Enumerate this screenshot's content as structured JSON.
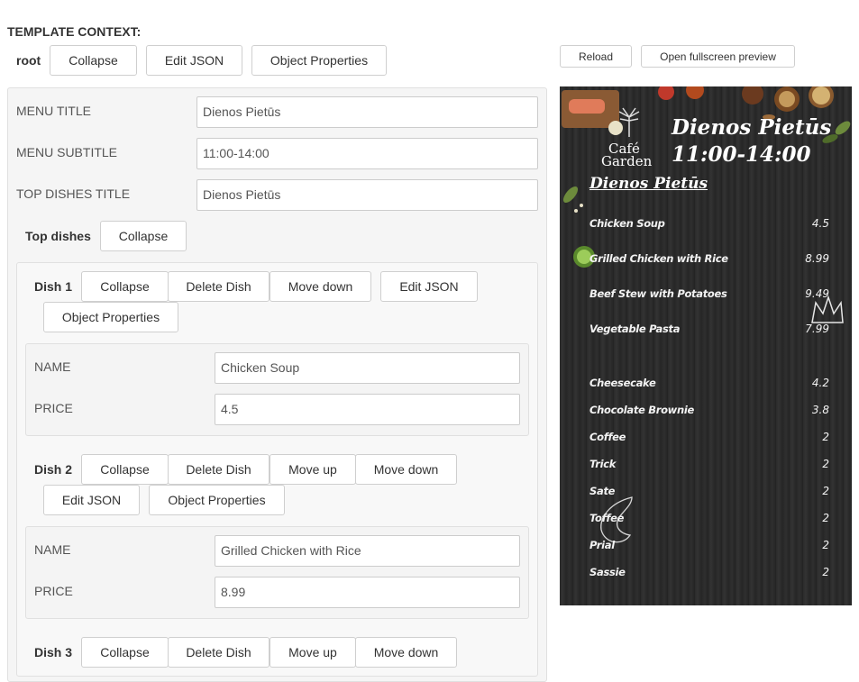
{
  "template_context_label": "TEMPLATE CONTEXT:",
  "root": {
    "label": "root",
    "collapse": "Collapse",
    "edit_json": "Edit JSON",
    "object_properties": "Object Properties"
  },
  "preview_toolbar": {
    "reload": "Reload",
    "open_fullscreen": "Open fullscreen preview"
  },
  "fields": {
    "menu_title": {
      "label": "MENU TITLE",
      "value": "Dienos Pietūs"
    },
    "menu_subtitle": {
      "label": "MENU SUBTITLE",
      "value": "11:00-14:00"
    },
    "top_dishes_title": {
      "label": "TOP DISHES TITLE",
      "value": "Dienos Pietūs"
    }
  },
  "top_dishes": {
    "label": "Top dishes",
    "collapse": "Collapse"
  },
  "dishes": [
    {
      "label": "Dish 1",
      "buttons": {
        "collapse": "Collapse",
        "delete": "Delete Dish",
        "move_down": "Move down",
        "edit_json": "Edit JSON",
        "object_properties": "Object Properties"
      },
      "name_label": "NAME",
      "name": "Chicken Soup",
      "price_label": "PRICE",
      "price": "4.5"
    },
    {
      "label": "Dish 2",
      "buttons": {
        "collapse": "Collapse",
        "delete": "Delete Dish",
        "move_up": "Move up",
        "move_down": "Move down",
        "edit_json": "Edit JSON",
        "object_properties": "Object Properties"
      },
      "name_label": "NAME",
      "name": "Grilled Chicken with Rice",
      "price_label": "PRICE",
      "price": "8.99"
    },
    {
      "label": "Dish 3",
      "buttons": {
        "collapse": "Collapse",
        "delete": "Delete Dish",
        "move_up": "Move up",
        "move_down": "Move down"
      }
    }
  ],
  "preview": {
    "logo_line1": "Café",
    "logo_line2": "Garden",
    "title": "Dienos Pietūs",
    "subtitle": "11:00-14:00",
    "section_title": "Dienos Pietūs",
    "top_items": [
      {
        "name": "Chicken Soup",
        "price": "4.5"
      },
      {
        "name": "Grilled Chicken with Rice",
        "price": "8.99"
      },
      {
        "name": "Beef Stew with Potatoes",
        "price": "9.49"
      },
      {
        "name": "Vegetable Pasta",
        "price": "7.99"
      }
    ],
    "bottom_items": [
      {
        "name": "Cheesecake",
        "price": "4.2"
      },
      {
        "name": "Chocolate Brownie",
        "price": "3.8"
      },
      {
        "name": "Coffee",
        "price": "2"
      },
      {
        "name": "Trick",
        "price": "2"
      },
      {
        "name": "Sate",
        "price": "2"
      },
      {
        "name": "Toffee",
        "price": "2"
      },
      {
        "name": "Prial",
        "price": "2"
      },
      {
        "name": "Sassie",
        "price": "2"
      }
    ]
  }
}
